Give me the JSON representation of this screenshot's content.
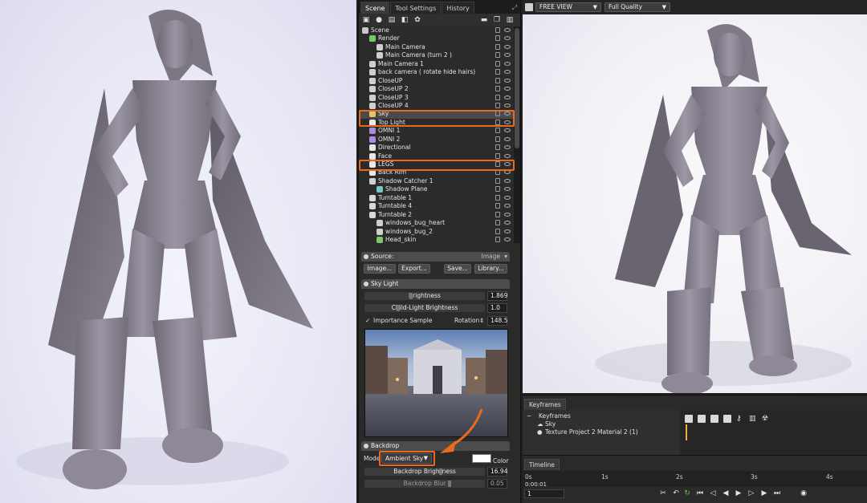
{
  "scene_tabs": [
    "Scene",
    "Tool Settings",
    "History"
  ],
  "tree": [
    {
      "label": "Scene",
      "indent": 0,
      "icon": "scene-icon"
    },
    {
      "label": "Render",
      "indent": 1,
      "icon": "gear-icon"
    },
    {
      "label": "Main Camera",
      "indent": 2,
      "icon": "camera-icon"
    },
    {
      "label": "Main Camera (turn 2 )",
      "indent": 2,
      "icon": "camera-icon"
    },
    {
      "label": "Main Camera 1",
      "indent": 1,
      "icon": "camera-icon"
    },
    {
      "label": "back camera ( rotate hide hairs)",
      "indent": 1,
      "icon": "camera-icon"
    },
    {
      "label": "CloseUP",
      "indent": 1,
      "icon": "camera-icon"
    },
    {
      "label": "CloseUP 2",
      "indent": 1,
      "icon": "camera-icon"
    },
    {
      "label": "CloseUP 3",
      "indent": 1,
      "icon": "camera-icon"
    },
    {
      "label": "CloseUP 4",
      "indent": 1,
      "icon": "camera-icon"
    },
    {
      "label": "Sky",
      "indent": 1,
      "icon": "sky-icon"
    },
    {
      "label": "Top Light",
      "indent": 1,
      "icon": "light-icon"
    },
    {
      "label": "OMNI 1",
      "indent": 1,
      "icon": "omni-icon"
    },
    {
      "label": "OMNI 2",
      "indent": 1,
      "icon": "omni-icon"
    },
    {
      "label": "Directional",
      "indent": 1,
      "icon": "light-icon"
    },
    {
      "label": "Face",
      "indent": 1,
      "icon": "light-icon"
    },
    {
      "label": "LEGS",
      "indent": 1,
      "icon": "light-icon"
    },
    {
      "label": "Back Rim",
      "indent": 1,
      "icon": "light-icon"
    },
    {
      "label": "Shadow Catcher 1",
      "indent": 1,
      "icon": "shadow-icon"
    },
    {
      "label": "Shadow Plane",
      "indent": 2,
      "icon": "plane-icon"
    },
    {
      "label": "Turntable 1",
      "indent": 1,
      "icon": "turntable-icon"
    },
    {
      "label": "Turntable 4",
      "indent": 1,
      "icon": "turntable-icon"
    },
    {
      "label": "Turntable 2",
      "indent": 1,
      "icon": "turntable-icon"
    },
    {
      "label": "windows_bug_heart",
      "indent": 2,
      "icon": "file-icon"
    },
    {
      "label": "windows_bug_2",
      "indent": 2,
      "icon": "file-icon"
    },
    {
      "label": "Head_skin",
      "indent": 2,
      "icon": "mesh-icon"
    }
  ],
  "source": {
    "title": "Source:",
    "value": "Image",
    "buttons": [
      "Image...",
      "Export...",
      "Save...",
      "Library..."
    ]
  },
  "sky_light": {
    "title": "Sky Light",
    "brightness_label": "Brightness",
    "brightness": "1.869",
    "child_label": "Child-Light Brightness",
    "child": "1.0",
    "importance_label": "Importance Sample",
    "rotation_label": "Rotation",
    "rotation": "148.5"
  },
  "backdrop": {
    "title": "Backdrop",
    "mode_label": "Mode",
    "mode_value": "Ambient Sky",
    "color_label": "Color",
    "brightness_label": "Backdrop Brightness",
    "brightness": "16.94",
    "blur_label": "Backdrop Blur",
    "blur": "0.05"
  },
  "viewport": {
    "view": "FREE VIEW",
    "quality": "Full Quality"
  },
  "keyframes": {
    "tab": "Keyframes",
    "root": "Keyframes",
    "items": [
      "Sky",
      "Texture Project 2 Material 2 (1)"
    ]
  },
  "timeline": {
    "tab": "Timeline",
    "ticks": [
      "0s",
      "1s",
      "2s",
      "3s",
      "4s"
    ],
    "time": "0:00:01",
    "frame": "1"
  }
}
